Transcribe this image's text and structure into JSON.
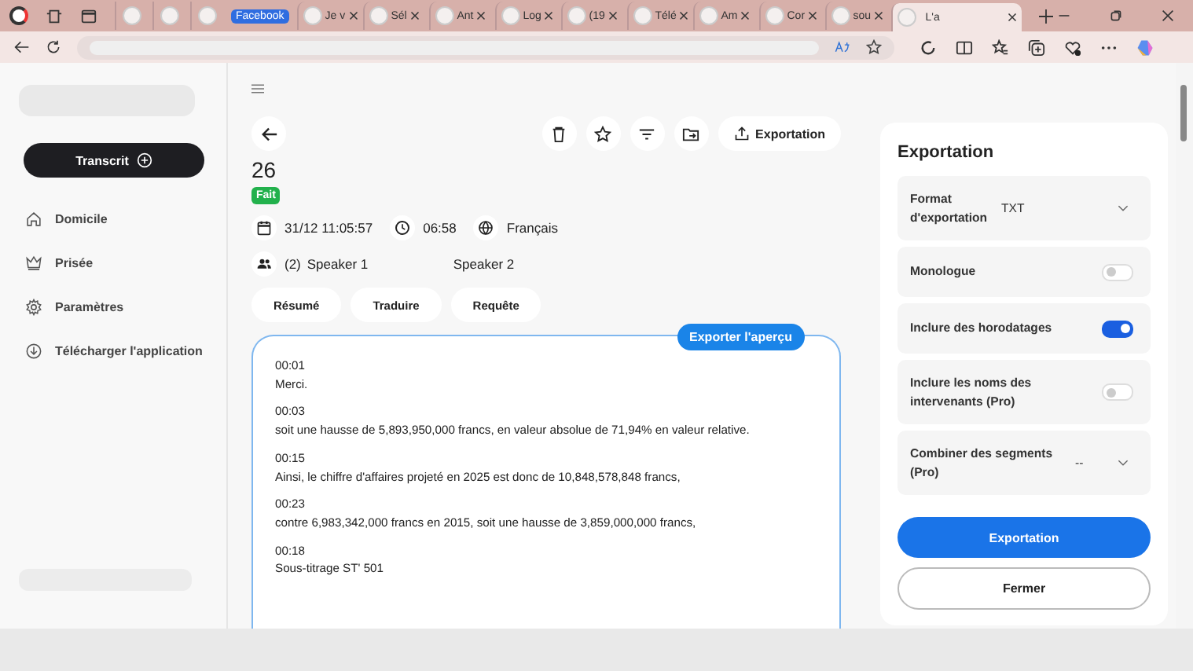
{
  "browser": {
    "tabs": [
      {
        "kind": "pinned",
        "selected": false
      },
      {
        "kind": "pinned",
        "selected": false
      },
      {
        "kind": "pinned",
        "selected": false
      },
      {
        "kind": "group",
        "title": "Facebook",
        "selected": false
      },
      {
        "kind": "tab",
        "title": "Je v",
        "selected": false
      },
      {
        "kind": "tab",
        "title": "Sél",
        "selected": false
      },
      {
        "kind": "tab",
        "title": "Ant",
        "selected": false
      },
      {
        "kind": "tab",
        "title": "Log",
        "selected": false
      },
      {
        "kind": "tab",
        "title": "(19",
        "selected": false
      },
      {
        "kind": "tab",
        "title": "Télé",
        "selected": false
      },
      {
        "kind": "tab",
        "title": "Am",
        "selected": false
      },
      {
        "kind": "tab",
        "title": "Cor",
        "selected": false
      },
      {
        "kind": "tab",
        "title": "sou",
        "selected": false
      },
      {
        "kind": "tab",
        "title": "L'a",
        "selected": true
      }
    ]
  },
  "sidebar": {
    "new_button": "Transcrit",
    "items": [
      {
        "label": "Domicile"
      },
      {
        "label": "Prisée"
      },
      {
        "label": "Paramètres"
      },
      {
        "label": "Télécharger l'application"
      }
    ]
  },
  "transcript": {
    "export_button": "Exportation",
    "title": "26",
    "status": "Fait",
    "date": "31/12 11:05:57",
    "duration": "06:58",
    "language": "Français",
    "speaker_count": "(2)",
    "speakers": [
      "Speaker 1",
      "Speaker 2"
    ],
    "actions": [
      "Résumé",
      "Traduire",
      "Requête"
    ],
    "preview_button": "Exporter l'aperçu",
    "segments": [
      {
        "time": "00:01",
        "text": "Merci."
      },
      {
        "time": "00:03",
        "text": "soit une hausse de 5,893,950,000 francs, en valeur absolue de 71,94% en valeur relative."
      },
      {
        "time": "00:15",
        "text": "Ainsi, le chiffre d'affaires projeté en 2025 est donc de 10,848,578,848 francs,"
      },
      {
        "time": "00:23",
        "text": "contre 6,983,342,000 francs en 2015, soit une hausse de 3,859,000,000 francs,"
      },
      {
        "time": "00:18",
        "text": "Sous-titrage ST' 501"
      }
    ]
  },
  "export_panel": {
    "title": "Exportation",
    "options": [
      {
        "kind": "select",
        "label": "Format d'exportation",
        "value": "TXT"
      },
      {
        "kind": "toggle",
        "label": "Monologue",
        "on": false
      },
      {
        "kind": "toggle",
        "label": "Inclure des horodatages",
        "on": true
      },
      {
        "kind": "toggle",
        "label": "Inclure les noms des intervenants (Pro)",
        "on": false
      },
      {
        "kind": "select",
        "label": "Combiner des segments (Pro)",
        "value": "--"
      }
    ],
    "primary_button": "Exportation",
    "secondary_button": "Fermer"
  }
}
